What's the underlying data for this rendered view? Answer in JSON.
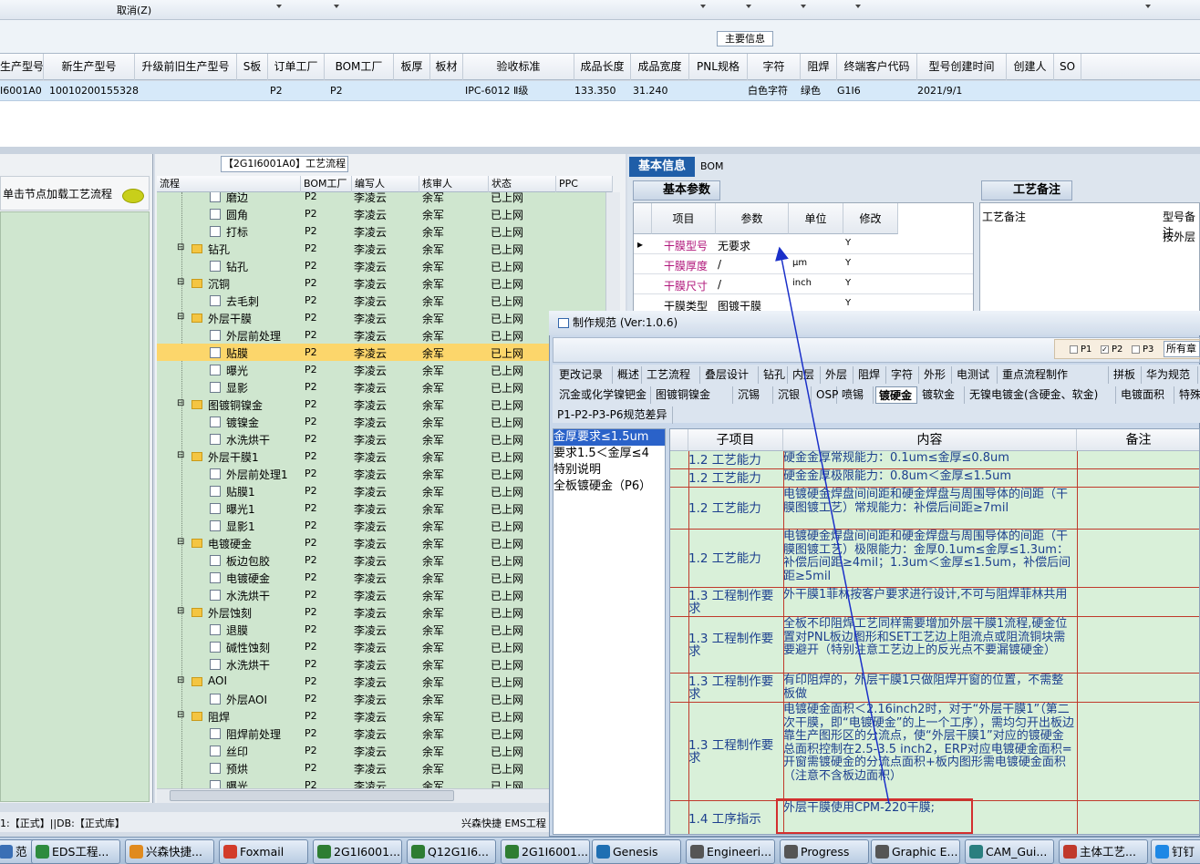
{
  "toolbar": {
    "cancel_label": "取消(Z)"
  },
  "main_info_label": "主要信息",
  "product_grid": {
    "headers": [
      "生产型号",
      "新生产型号",
      "升级前旧生产型号",
      "S板",
      "订单工厂",
      "BOM工厂",
      "板厚",
      "板材",
      "验收标准",
      "成品长度",
      "成品宽度",
      "PNL规格",
      "字符",
      "阻焊",
      "终端客户代码",
      "型号创建时间",
      "创建人",
      "SO"
    ],
    "row": [
      "I6001A0",
      "10010200155328",
      "",
      "",
      "P2",
      "P2",
      "",
      "",
      "IPC-6012 Ⅱ级",
      "133.350",
      "31.240",
      "",
      "白色字符",
      "绿色",
      "G1I6",
      "2021/9/1",
      "",
      ""
    ]
  },
  "left_panel": {
    "hint": "单击节点加载工艺流程"
  },
  "process_panel": {
    "title": "【2G1I6001A0】工艺流程",
    "headers": [
      "流程",
      "BOM工厂",
      "编写人",
      "核审人",
      "状态",
      "PPC"
    ],
    "rows": [
      {
        "name": "磨边",
        "level": 2,
        "type": "doc",
        "bom": "P2",
        "author": "李凌云",
        "reviewer": "余军",
        "status": "已上网"
      },
      {
        "name": "圆角",
        "level": 2,
        "type": "doc",
        "bom": "P2",
        "author": "李凌云",
        "reviewer": "余军",
        "status": "已上网"
      },
      {
        "name": "打标",
        "level": 2,
        "type": "doc",
        "bom": "P2",
        "author": "李凌云",
        "reviewer": "余军",
        "status": "已上网"
      },
      {
        "name": "钻孔",
        "level": 1,
        "type": "folder",
        "bom": "P2",
        "author": "李凌云",
        "reviewer": "余军",
        "status": "已上网"
      },
      {
        "name": "钻孔",
        "level": 2,
        "type": "doc",
        "bom": "P2",
        "author": "李凌云",
        "reviewer": "余军",
        "status": "已上网"
      },
      {
        "name": "沉铜",
        "level": 1,
        "type": "folder",
        "bom": "P2",
        "author": "李凌云",
        "reviewer": "余军",
        "status": "已上网"
      },
      {
        "name": "去毛刺",
        "level": 2,
        "type": "doc",
        "bom": "P2",
        "author": "李凌云",
        "reviewer": "余军",
        "status": "已上网"
      },
      {
        "name": "外层干膜",
        "level": 1,
        "type": "folder",
        "bom": "P2",
        "author": "李凌云",
        "reviewer": "余军",
        "status": "已上网"
      },
      {
        "name": "外层前处理",
        "level": 2,
        "type": "doc",
        "bom": "P2",
        "author": "李凌云",
        "reviewer": "余军",
        "status": "已上网"
      },
      {
        "name": "贴膜",
        "level": 2,
        "type": "doc",
        "bom": "P2",
        "author": "李凌云",
        "reviewer": "余军",
        "status": "已上网",
        "selected": true
      },
      {
        "name": "曝光",
        "level": 2,
        "type": "doc",
        "bom": "P2",
        "author": "李凌云",
        "reviewer": "余军",
        "status": "已上网"
      },
      {
        "name": "显影",
        "level": 2,
        "type": "doc",
        "bom": "P2",
        "author": "李凌云",
        "reviewer": "余军",
        "status": "已上网"
      },
      {
        "name": "图镀铜镍金",
        "level": 1,
        "type": "folder",
        "bom": "P2",
        "author": "李凌云",
        "reviewer": "余军",
        "status": "已上网"
      },
      {
        "name": "镀镍金",
        "level": 2,
        "type": "doc",
        "bom": "P2",
        "author": "李凌云",
        "reviewer": "余军",
        "status": "已上网"
      },
      {
        "name": "水洗烘干",
        "level": 2,
        "type": "doc",
        "bom": "P2",
        "author": "李凌云",
        "reviewer": "余军",
        "status": "已上网"
      },
      {
        "name": "外层干膜1",
        "level": 1,
        "type": "folder",
        "bom": "P2",
        "author": "李凌云",
        "reviewer": "余军",
        "status": "已上网"
      },
      {
        "name": "外层前处理1",
        "level": 2,
        "type": "doc",
        "bom": "P2",
        "author": "李凌云",
        "reviewer": "余军",
        "status": "已上网"
      },
      {
        "name": "贴膜1",
        "level": 2,
        "type": "doc",
        "bom": "P2",
        "author": "李凌云",
        "reviewer": "余军",
        "status": "已上网"
      },
      {
        "name": "曝光1",
        "level": 2,
        "type": "doc",
        "bom": "P2",
        "author": "李凌云",
        "reviewer": "余军",
        "status": "已上网"
      },
      {
        "name": "显影1",
        "level": 2,
        "type": "doc",
        "bom": "P2",
        "author": "李凌云",
        "reviewer": "余军",
        "status": "已上网"
      },
      {
        "name": "电镀硬金",
        "level": 1,
        "type": "folder",
        "bom": "P2",
        "author": "李凌云",
        "reviewer": "余军",
        "status": "已上网"
      },
      {
        "name": "板边包胶",
        "level": 2,
        "type": "doc",
        "bom": "P2",
        "author": "李凌云",
        "reviewer": "余军",
        "status": "已上网"
      },
      {
        "name": "电镀硬金",
        "level": 2,
        "type": "doc",
        "bom": "P2",
        "author": "李凌云",
        "reviewer": "余军",
        "status": "已上网"
      },
      {
        "name": "水洗烘干",
        "level": 2,
        "type": "doc",
        "bom": "P2",
        "author": "李凌云",
        "reviewer": "余军",
        "status": "已上网"
      },
      {
        "name": "外层蚀刻",
        "level": 1,
        "type": "folder",
        "bom": "P2",
        "author": "李凌云",
        "reviewer": "余军",
        "status": "已上网"
      },
      {
        "name": "退膜",
        "level": 2,
        "type": "doc",
        "bom": "P2",
        "author": "李凌云",
        "reviewer": "余军",
        "status": "已上网"
      },
      {
        "name": "碱性蚀刻",
        "level": 2,
        "type": "doc",
        "bom": "P2",
        "author": "李凌云",
        "reviewer": "余军",
        "status": "已上网"
      },
      {
        "name": "水洗烘干",
        "level": 2,
        "type": "doc",
        "bom": "P2",
        "author": "李凌云",
        "reviewer": "余军",
        "status": "已上网"
      },
      {
        "name": "AOI",
        "level": 1,
        "type": "folder",
        "bom": "P2",
        "author": "李凌云",
        "reviewer": "余军",
        "status": "已上网"
      },
      {
        "name": "外层AOI",
        "level": 2,
        "type": "doc",
        "bom": "P2",
        "author": "李凌云",
        "reviewer": "余军",
        "status": "已上网"
      },
      {
        "name": "阻焊",
        "level": 1,
        "type": "folder",
        "bom": "P2",
        "author": "李凌云",
        "reviewer": "余军",
        "status": "已上网"
      },
      {
        "name": "阻焊前处理",
        "level": 2,
        "type": "doc",
        "bom": "P2",
        "author": "李凌云",
        "reviewer": "余军",
        "status": "已上网"
      },
      {
        "name": "丝印",
        "level": 2,
        "type": "doc",
        "bom": "P2",
        "author": "李凌云",
        "reviewer": "余军",
        "status": "已上网"
      },
      {
        "name": "预烘",
        "level": 2,
        "type": "doc",
        "bom": "P2",
        "author": "李凌云",
        "reviewer": "余军",
        "status": "已上网"
      },
      {
        "name": "曝光",
        "level": 2,
        "type": "doc",
        "bom": "P2",
        "author": "李凌云",
        "reviewer": "余军",
        "status": "已上网"
      }
    ]
  },
  "status_bar": {
    "left": "1:【正式】||DB:【正式库】",
    "right": "兴森快捷  EMS工程"
  },
  "info_panel": {
    "tab_basic": "基本信息",
    "tab_bom": "BOM",
    "sub_params": "基本参数",
    "sub_notes": "工艺备注",
    "param_headers": [
      "项目",
      "参数",
      "单位",
      "修改"
    ],
    "params": [
      {
        "item": "干膜型号",
        "value": "无要求",
        "unit": "",
        "edit": "Y"
      },
      {
        "item": "干膜厚度",
        "value": "/",
        "unit": "μm",
        "edit": "Y"
      },
      {
        "item": "干膜尺寸",
        "value": "/",
        "unit": "inch",
        "edit": "Y"
      },
      {
        "item": "干膜类型",
        "value": "图镀干膜",
        "unit": "",
        "edit": "Y"
      }
    ],
    "note_headers": [
      "工艺备注",
      "型号备注"
    ],
    "note_value": "按外层"
  },
  "dialog": {
    "title": "制作规范 (Ver:1.0.6)",
    "plants": [
      "P1",
      "P2",
      "P3"
    ],
    "scope": "所有章",
    "tabs_row1": [
      "更改记录",
      "概述",
      "工艺流程",
      "叠层设计",
      "钻孔",
      "内层",
      "外层",
      "阻焊",
      "字符",
      "外形",
      "电测试",
      "重点流程制作",
      "拼板",
      "华为规范"
    ],
    "tabs_row2": [
      "沉金或化学镍钯金",
      "图镀铜镍金",
      "沉锡",
      "沉银",
      "OSP",
      "喷锡",
      "镀硬金",
      "镀软金",
      "无镍电镀金(含硬金、软金)",
      "电镀面积",
      "特殊"
    ],
    "tabs_row3": [
      "P1-P2-P3-P6规范差异"
    ],
    "left_list": [
      "金厚要求≤1.5um",
      "要求1.5＜金厚≤4",
      "特别说明",
      "全板镀硬金（P6）"
    ],
    "grid_headers": [
      "子项目",
      "内容",
      "备注"
    ],
    "rows": [
      {
        "sub": "1.2 工艺能力",
        "content": "硬金金厚常规能力：0.1um≤金厚≤0.8um"
      },
      {
        "sub": "1.2 工艺能力",
        "content": "硬金金厚极限能力：0.8um＜金厚≤1.5um"
      },
      {
        "sub": "1.2 工艺能力",
        "content": "电镀硬金焊盘间间距和硬金焊盘与周围导体的间距（干膜图镀工艺）常规能力：补偿后间距≥7mil"
      },
      {
        "sub": "1.2 工艺能力",
        "content": "电镀硬金焊盘间间距和硬金焊盘与周围导体的间距（干膜图镀工艺）极限能力：金厚0.1um≤金厚≤1.3um：补偿后间距≥4mil；1.3um＜金厚≤1.5um，补偿后间距≥5mil"
      },
      {
        "sub": "1.3 工程制作要求",
        "content": "外干膜1菲林按客户要求进行设计,不可与阻焊菲林共用"
      },
      {
        "sub": "1.3 工程制作要求",
        "content": "全板不印阻焊工艺同样需要增加外层干膜1流程,硬金位置对PNL板边图形和SET工艺边上阻流点或阻流铜块需要避开（特别注意工艺边上的反光点不要漏镀硬金）"
      },
      {
        "sub": "1.3 工程制作要求",
        "content": "有印阻焊的，外层干膜1只做阻焊开窗的位置，不需整板做"
      },
      {
        "sub": "1.3 工程制作要求",
        "content": "电镀硬金面积＜2.16inch2时，对于“外层干膜1”（第二次干膜，即“电镀硬金”的上一个工序），需均匀开出板边靠生产图形区的分流点，使“外层干膜1”对应的镀硬金总面积控制在2.5-3.5 inch2，ERP对应电镀硬金面积=开窗需镀硬金的分流点面积+板内图形需电镀硬金面积（注意不含板边面积）"
      },
      {
        "sub": "1.4 工序指示",
        "content": "外层干膜使用CPM-220干膜;"
      }
    ]
  },
  "taskbar": [
    {
      "label": "范 (...",
      "color": "#3a6fb5"
    },
    {
      "label": "EDS工程...",
      "color": "#2e8b3e"
    },
    {
      "label": "兴森快捷...",
      "color": "#e08a1e"
    },
    {
      "label": "Foxmail",
      "color": "#d23b2a"
    },
    {
      "label": "2G1I6001...",
      "color": "#2e7d32"
    },
    {
      "label": "Q12G1I6...",
      "color": "#2e7d32"
    },
    {
      "label": "2G1I6001...",
      "color": "#2e7d32"
    },
    {
      "label": "Genesis",
      "color": "#1f6fb2"
    },
    {
      "label": "Engineeri...",
      "color": "#555"
    },
    {
      "label": "Progress",
      "color": "#555"
    },
    {
      "label": "Graphic E...",
      "color": "#555"
    },
    {
      "label": "CAM_Gui...",
      "color": "#2a7f7f"
    },
    {
      "label": "主体工艺...",
      "color": "#c0392b"
    },
    {
      "label": "钉钉",
      "color": "#1e88e5"
    }
  ]
}
